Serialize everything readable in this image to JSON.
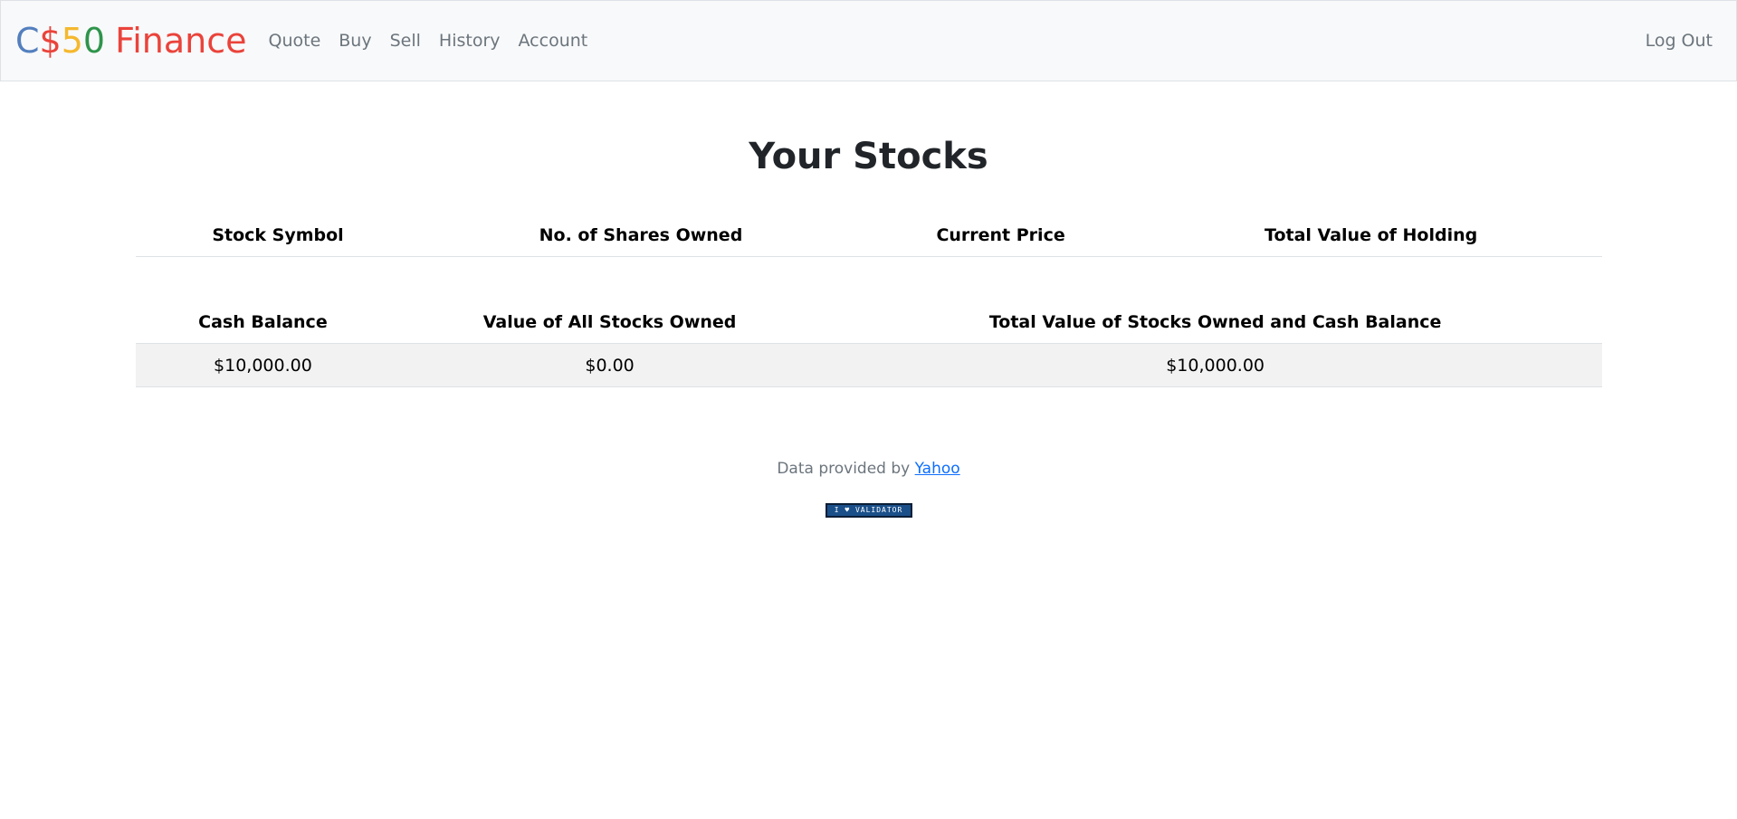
{
  "brand": {
    "c": "C",
    "dollar": "$",
    "five": "5",
    "zero": "0",
    "finance": "Finance",
    "colors": {
      "c": "#537fbe",
      "dollar": "#ea433b",
      "five": "#f5b82e",
      "zero": "#2e944b",
      "finance": "#ea433b"
    }
  },
  "nav": {
    "items": [
      {
        "label": "Quote"
      },
      {
        "label": "Buy"
      },
      {
        "label": "Sell"
      },
      {
        "label": "History"
      },
      {
        "label": "Account"
      }
    ],
    "logout_label": "Log Out"
  },
  "main": {
    "title": "Your Stocks",
    "stocks_table": {
      "headers": [
        "Stock Symbol",
        "No. of Shares Owned",
        "Current Price",
        "Total Value of Holding"
      ],
      "rows": []
    },
    "summary_table": {
      "headers": [
        "Cash Balance",
        "Value of All Stocks Owned",
        "Total Value of Stocks Owned and Cash Balance"
      ],
      "row": [
        "$10,000.00",
        "$0.00",
        "$10,000.00"
      ]
    }
  },
  "footer": {
    "text": "Data provided by ",
    "link_label": "Yahoo",
    "badge_label": "I ♥ VALIDATOR"
  }
}
